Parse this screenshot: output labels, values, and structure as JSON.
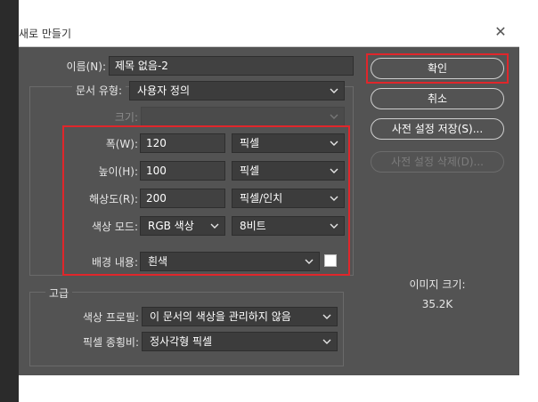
{
  "dialog": {
    "title": "새로 만들기",
    "close_icon": "close-icon"
  },
  "name": {
    "label": "이름(N):",
    "value": "제목 없음-2"
  },
  "document_type": {
    "label": "문서 유형:",
    "value": "사용자 정의"
  },
  "size": {
    "label": "크기:",
    "value": ""
  },
  "width": {
    "label": "폭(W):",
    "value": "120",
    "unit": "픽셀"
  },
  "height": {
    "label": "높이(H):",
    "value": "100",
    "unit": "픽셀"
  },
  "resolution": {
    "label": "해상도(R):",
    "value": "200",
    "unit": "픽셀/인치"
  },
  "color_mode": {
    "label": "색상 모드:",
    "mode": "RGB 색상",
    "depth": "8비트"
  },
  "background": {
    "label": "배경 내용:",
    "value": "흰색",
    "swatch_color": "#ffffff"
  },
  "advanced": {
    "label": "고급",
    "color_profile": {
      "label": "색상 프로필:",
      "value": "이 문서의 색상을 관리하지 않음"
    },
    "pixel_aspect": {
      "label": "픽셀 종횡비:",
      "value": "정사각형 픽셀"
    }
  },
  "buttons": {
    "ok": "확인",
    "cancel": "취소",
    "save_preset": "사전 설정 저장(S)...",
    "delete_preset": "사전 설정 삭제(D)..."
  },
  "image_size": {
    "label": "이미지 크기:",
    "value": "35.2K"
  },
  "colors": {
    "highlight": "#e0262b",
    "dialog_bg": "#535353"
  }
}
